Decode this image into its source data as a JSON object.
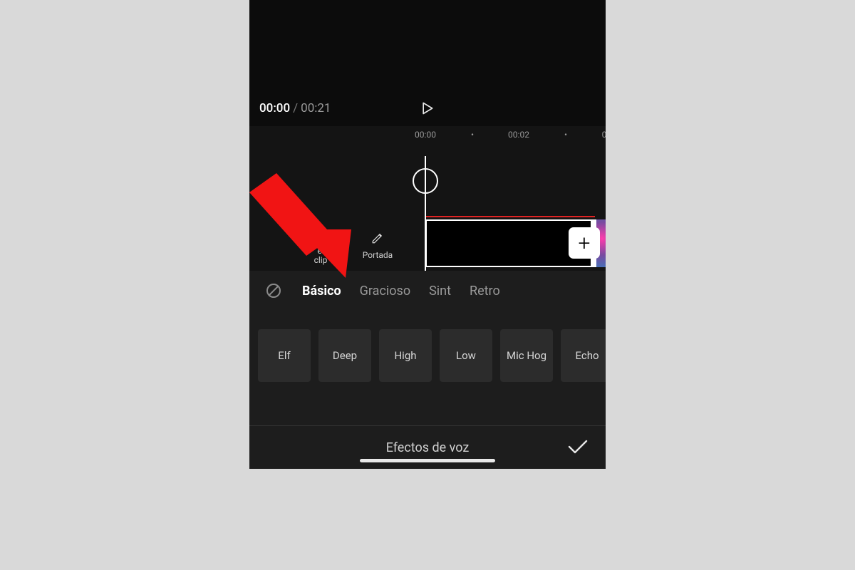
{
  "playback": {
    "current": "00:00",
    "separator": "/",
    "total": "00:21"
  },
  "ruler": {
    "t0": "00:00",
    "dot1": "•",
    "t2": "00:02",
    "dot2": "•",
    "t4": "0"
  },
  "tools": {
    "clip_line1": "el",
    "clip_line2": "clip",
    "cover": "Portada"
  },
  "add_label": "+",
  "tabs": {
    "items": [
      {
        "label": "Básico",
        "active": true
      },
      {
        "label": "Gracioso",
        "active": false
      },
      {
        "label": "Sint",
        "active": false
      },
      {
        "label": "Retro",
        "active": false
      }
    ]
  },
  "presets": [
    {
      "label": "Elf"
    },
    {
      "label": "Deep"
    },
    {
      "label": "High"
    },
    {
      "label": "Low"
    },
    {
      "label": "Mic Hog"
    },
    {
      "label": "Echo"
    }
  ],
  "panel_title": "Efectos de voz"
}
